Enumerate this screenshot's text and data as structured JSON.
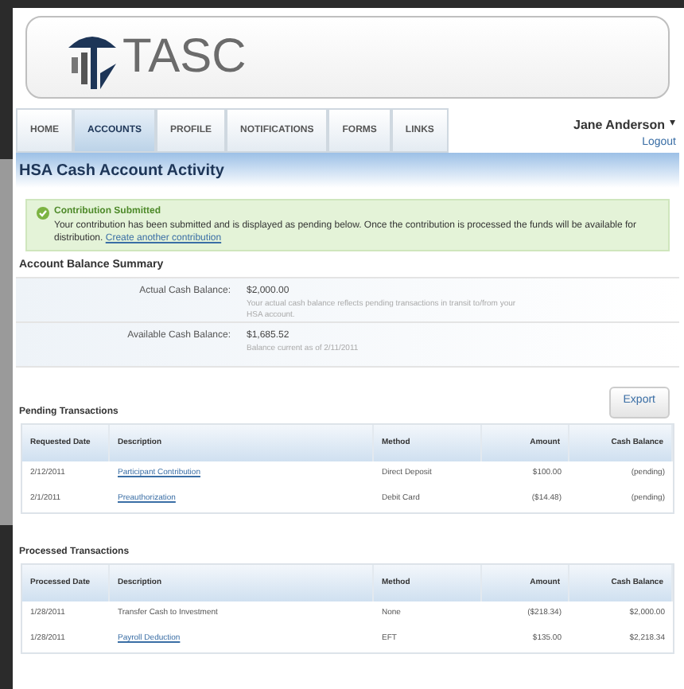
{
  "header": {
    "logo_text": "TASC"
  },
  "tabs": [
    {
      "label": "HOME",
      "selected": false
    },
    {
      "label": "ACCOUNTS",
      "selected": true
    },
    {
      "label": "PROFILE",
      "selected": false
    },
    {
      "label": "NOTIFICATIONS",
      "selected": false
    },
    {
      "label": "FORMS",
      "selected": false
    },
    {
      "label": "LINKS",
      "selected": false
    }
  ],
  "user": {
    "name": "Jane Anderson",
    "menu_glyph": "▾",
    "logout": "Logout"
  },
  "page_title": "HSA Cash Account Activity",
  "notice": {
    "title": "Contribution Submitted",
    "message": "Your contribution has been submitted and is displayed as pending below. Once the contribution is processed the funds will be available for distribution.",
    "link": "Create another contribution"
  },
  "balance_summary": {
    "title": "Account Balance Summary",
    "rows": [
      {
        "label": "Actual Cash Balance:",
        "value": "$2,000.00",
        "note": "Your actual cash balance reflects pending transactions in transit to/from your HSA account."
      },
      {
        "label": "Available Cash Balance:",
        "value": "$1,685.52",
        "note": "Balance current as of 2/11/2011"
      }
    ]
  },
  "export_button": "Export",
  "pending": {
    "title": "Pending Transactions",
    "columns": [
      "Requested Date",
      "Description",
      "Method",
      "Amount",
      "Cash Balance"
    ],
    "rows": [
      {
        "date": "2/12/2011",
        "description": "Participant Contribution",
        "link": true,
        "method": "Direct Deposit",
        "amount": "$100.00",
        "balance": "(pending)"
      },
      {
        "date": "2/1/2011",
        "description": "Preauthorization",
        "link": true,
        "method": "Debit Card",
        "amount": "($14.48)",
        "balance": "(pending)"
      }
    ]
  },
  "processed": {
    "title": "Processed Transactions",
    "columns": [
      "Processed Date",
      "Description",
      "Method",
      "Amount",
      "Cash Balance"
    ],
    "rows": [
      {
        "date": "1/28/2011",
        "description": "Transfer Cash to Investment",
        "link": false,
        "method": "None",
        "amount": "($218.34)",
        "balance": "$2,000.00"
      },
      {
        "date": "1/28/2011",
        "description": "Payroll Deduction",
        "link": true,
        "method": "EFT",
        "amount": "$135.00",
        "balance": "$2,218.34"
      }
    ]
  }
}
